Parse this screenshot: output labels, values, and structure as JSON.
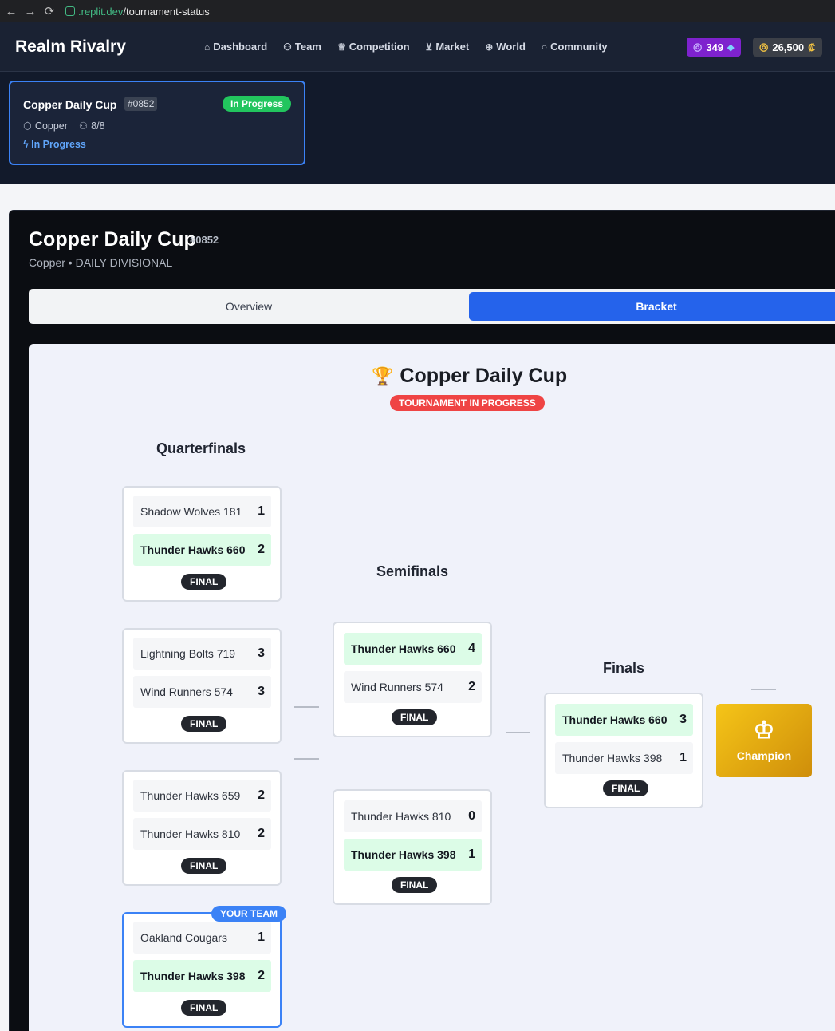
{
  "browser": {
    "back": "←",
    "forward": "→",
    "reload": "⟳",
    "url_domain": ".replit.dev",
    "url_path": "/tournament-status"
  },
  "header": {
    "brand": "Realm Rivalry",
    "nav": [
      {
        "label": "Dashboard",
        "icon": "home-icon"
      },
      {
        "label": "Team",
        "icon": "users-icon"
      },
      {
        "label": "Competition",
        "icon": "trophy-icon"
      },
      {
        "label": "Market",
        "icon": "cart-icon"
      },
      {
        "label": "World",
        "icon": "globe-icon"
      },
      {
        "label": "Community",
        "icon": "chat-icon"
      }
    ],
    "gems": "349",
    "coins": "26,500",
    "coin_symbol": "₡"
  },
  "tournament_card": {
    "name": "Copper Daily Cup",
    "id": "#0852",
    "status": "In Progress",
    "division": "Copper",
    "participants": "8/8",
    "state": "In Progress"
  },
  "main": {
    "title": "Copper Daily Cup",
    "id": "#0852",
    "subtitle": "Copper • DAILY DIVISIONAL",
    "tabs": {
      "overview": "Overview",
      "bracket": "Bracket"
    }
  },
  "bracket": {
    "title": "Copper Daily Cup",
    "badge": "TOURNAMENT IN PROGRESS",
    "rounds": {
      "quarterfinals": "Quarterfinals",
      "semifinals": "Semifinals",
      "finals": "Finals"
    },
    "final_label": "FINAL",
    "your_team_label": "YOUR TEAM",
    "champion_label": "Champion",
    "quarterfinals": [
      {
        "home": "Shadow Wolves 181",
        "home_score": "1",
        "away": "Thunder Hawks 660",
        "away_score": "2",
        "winner": "away"
      },
      {
        "home": "Lightning Bolts 719",
        "home_score": "3",
        "away": "Wind Runners 574",
        "away_score": "3",
        "winner": "none"
      },
      {
        "home": "Thunder Hawks 659",
        "home_score": "2",
        "away": "Thunder Hawks 810",
        "away_score": "2",
        "winner": "none"
      },
      {
        "home": "Oakland Cougars",
        "home_score": "1",
        "away": "Thunder Hawks 398",
        "away_score": "2",
        "winner": "away"
      }
    ],
    "semifinals": [
      {
        "home": "Thunder Hawks 660",
        "home_score": "4",
        "away": "Wind Runners 574",
        "away_score": "2",
        "winner": "home"
      },
      {
        "home": "Thunder Hawks 810",
        "home_score": "0",
        "away": "Thunder Hawks 398",
        "away_score": "1",
        "winner": "away"
      }
    ],
    "finals": [
      {
        "home": "Thunder Hawks 660",
        "home_score": "3",
        "away": "Thunder Hawks 398",
        "away_score": "1",
        "winner": "home"
      }
    ]
  }
}
